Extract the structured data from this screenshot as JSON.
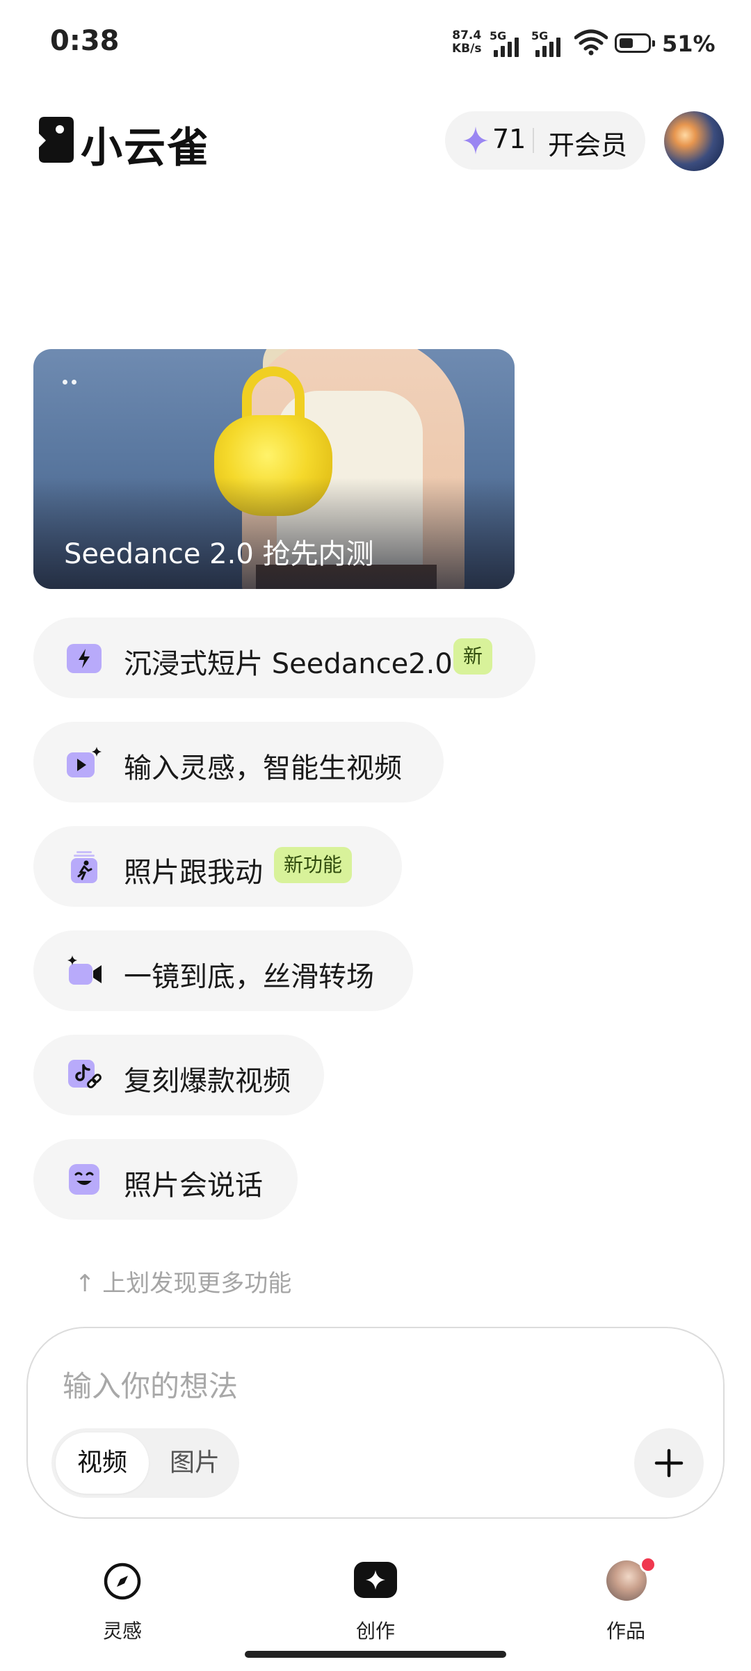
{
  "status_bar": {
    "time": "0:38",
    "net_speed_value": "87.4",
    "net_speed_unit": "KB/s",
    "sim1": "5G",
    "sim2": "5G",
    "battery": "51%",
    "battery_level": 0.51
  },
  "header": {
    "app_name": "小云雀",
    "credits": "71",
    "vip_label": "开会员",
    "icons": [
      "logo-icon",
      "sparkle-icon",
      "avatar"
    ]
  },
  "banner": {
    "caption": "Seedance 2.0 抢先内测"
  },
  "features": [
    {
      "label": "沉浸式短片 Seedance2.0",
      "badge": "新",
      "icon": "lightning-icon"
    },
    {
      "label": "输入灵感，智能生视频",
      "badge": null,
      "icon": "video-sparkle-icon"
    },
    {
      "label": "照片跟我动",
      "badge": "新功能",
      "icon": "dancing-photo-icon"
    },
    {
      "label": "一镜到底，丝滑转场",
      "badge": null,
      "icon": "camera-sparkle-icon"
    },
    {
      "label": "复刻爆款视频",
      "badge": null,
      "icon": "tiktok-link-icon"
    },
    {
      "label": "照片会说话",
      "badge": null,
      "icon": "smiling-face-icon"
    }
  ],
  "swipe_hint": "↑ 上划发现更多功能",
  "composer": {
    "placeholder": "输入你的想法",
    "mode_video": "视频",
    "mode_image": "图片",
    "selected_mode": "视频"
  },
  "nav": {
    "tabs": [
      {
        "label": "灵感",
        "icon": "compass-icon"
      },
      {
        "label": "创作",
        "icon": "create-icon"
      },
      {
        "label": "作品",
        "icon": "works-avatar"
      }
    ],
    "works_has_notification": true
  },
  "colors": {
    "accent_purple": "#a99af7",
    "badge_green": "#d8f29a",
    "notification_red": "#f0384f"
  }
}
